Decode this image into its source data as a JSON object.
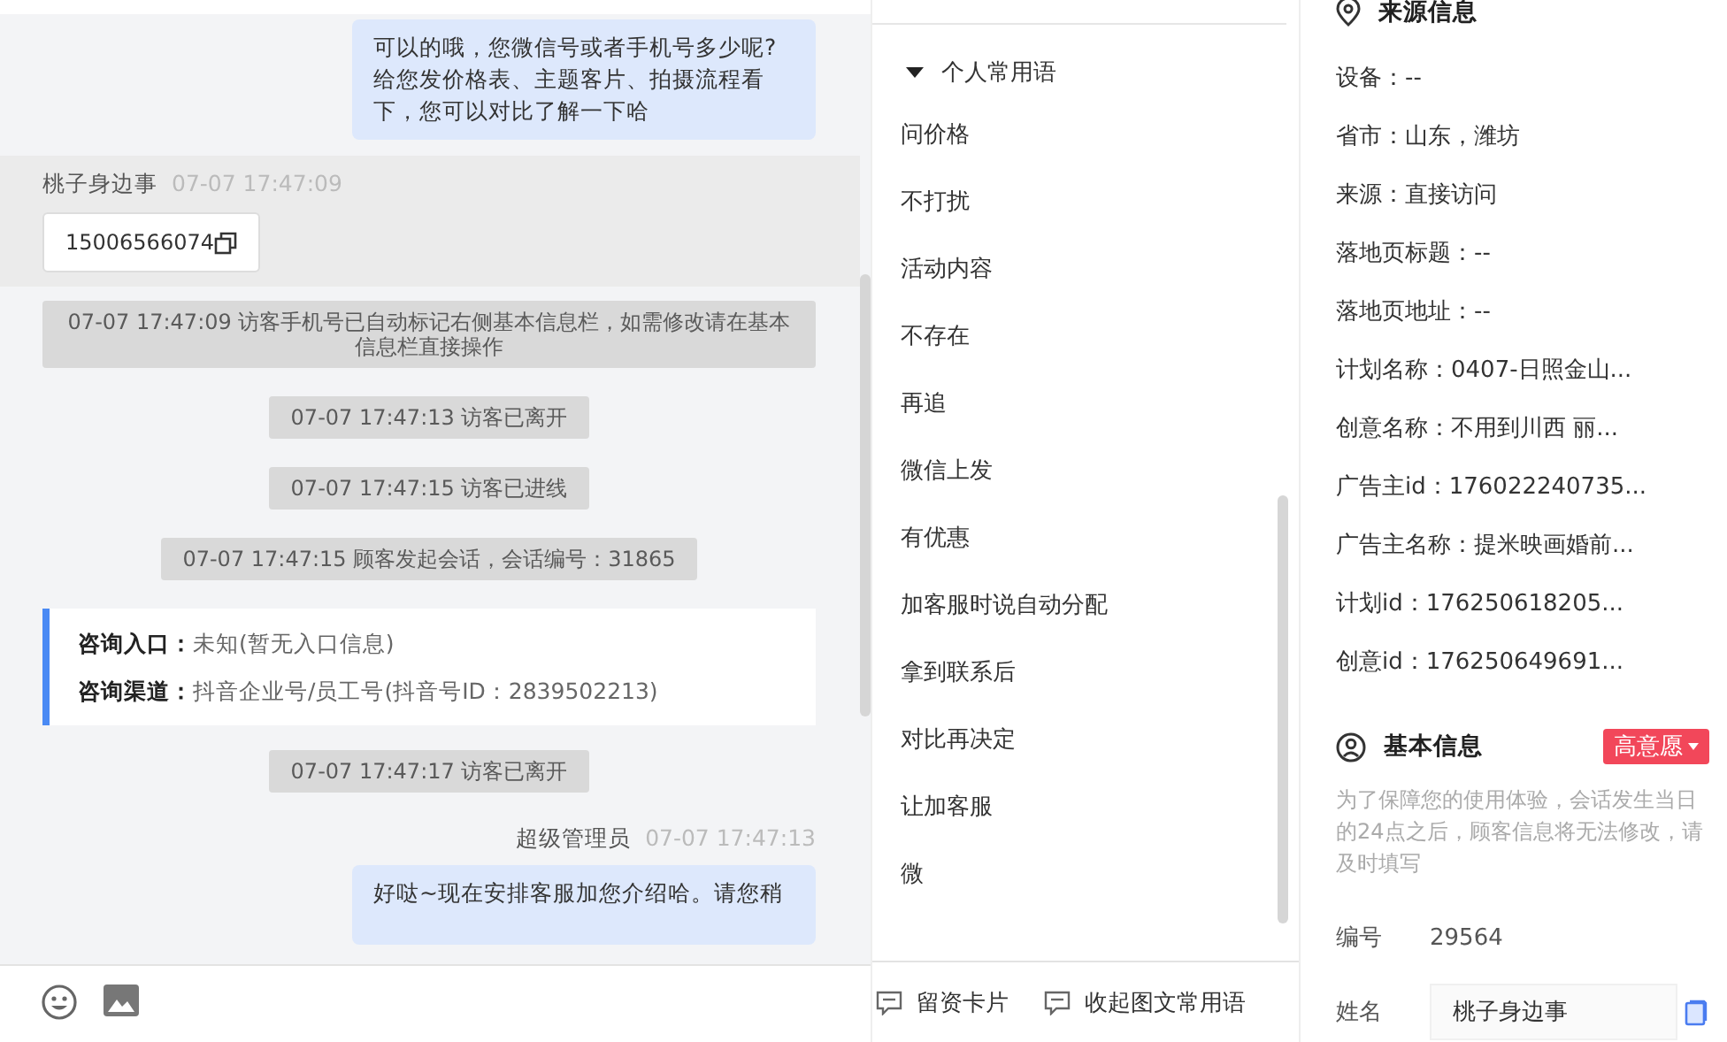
{
  "chat": {
    "messages": [
      {
        "kind": "bubble",
        "text": "可以的哦，您微信号或者手机号多少呢?给您发价格表、主题客片、拍摄流程看下，您可以对比了解一下哈"
      },
      {
        "kind": "visitor",
        "name": "桃子身边事",
        "time": "07-07 17:47:09",
        "phone": "15006566074"
      },
      {
        "kind": "notice",
        "text": "07-07 17:47:09 访客手机号已自动标记右侧基本信息栏，如需修改请在基本信息栏直接操作"
      },
      {
        "kind": "notice",
        "text": "07-07 17:47:13 访客已离开"
      },
      {
        "kind": "notice",
        "text": "07-07 17:47:15 访客已进线"
      },
      {
        "kind": "notice",
        "text": "07-07 17:47:15 顾客发起会话，会话编号：31865"
      },
      {
        "kind": "source",
        "rows": [
          {
            "label": "咨询入口：",
            "value": "未知(暂无入口信息)"
          },
          {
            "label": "咨询渠道：",
            "value": "抖音企业号/员工号(抖音号ID：2839502213)"
          }
        ]
      },
      {
        "kind": "notice",
        "text": "07-07 17:47:17 访客已离开"
      },
      {
        "kind": "agent",
        "name": "超级管理员",
        "time": "07-07 17:47:13",
        "text": "好哒~现在安排客服加您介绍哈。请您稍"
      }
    ]
  },
  "phrases": {
    "group": {
      "label": "个人常用语",
      "expanded": true
    },
    "items": [
      "问价格",
      "不打扰",
      "活动内容",
      "不存在",
      "再追",
      "微信上发",
      "有优惠",
      "加客服时说自动分配",
      "拿到联系后",
      "对比再决定",
      "让加客服",
      "微"
    ],
    "footer": [
      "留资卡片",
      "收起图文常用语"
    ]
  },
  "source_info": {
    "title": "来源信息",
    "rows": [
      "设备：--",
      "省市：山东，潍坊",
      "来源：直接访问",
      "落地页标题：--",
      "落地页地址：--",
      "计划名称：0407-日照金山...",
      "创意名称：不用到川西 丽...",
      "广告主id：176022240735...",
      "广告主名称：提米映画婚前...",
      "计划id：176250618205...",
      "创意id：176250649691..."
    ]
  },
  "basic_info": {
    "title": "基本信息",
    "intent": "高意愿",
    "notice": "为了保障您的使用体验，会话发生当日的24点之后，顾客信息将无法修改，请及时填写",
    "fields": [
      {
        "kind": "text",
        "label": "编号",
        "value": "29564"
      },
      {
        "kind": "input",
        "label": "姓名",
        "value": "桃子身边事"
      }
    ]
  }
}
